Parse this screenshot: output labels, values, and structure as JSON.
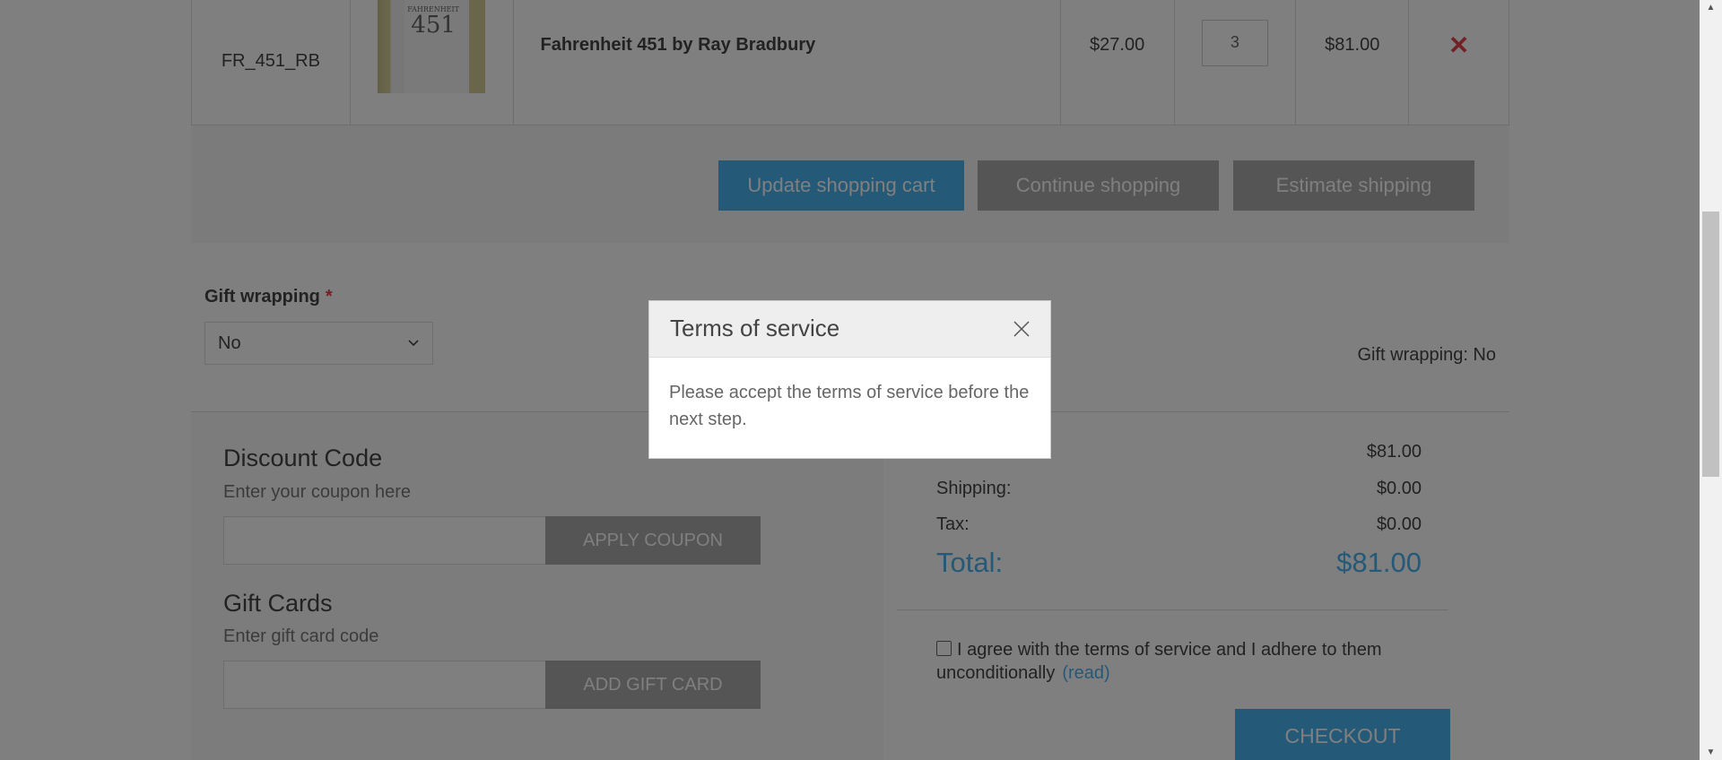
{
  "cart_row": {
    "sku": "FR_451_RB",
    "product_name": "Fahrenheit 451 by Ray Bradbury",
    "unit_price": "$27.00",
    "quantity": "3",
    "subtotal": "$81.00",
    "remove_symbol": "✕",
    "book_cover_top": "FAHRENHEIT",
    "book_cover_number": "451"
  },
  "cart_buttons": {
    "update": "Update shopping cart",
    "continue": "Continue shopping",
    "estimate": "Estimate shipping"
  },
  "gift_wrapping": {
    "label": "Gift wrapping",
    "required_mark": "*",
    "selected": "No",
    "summary": "Gift wrapping: No"
  },
  "discount": {
    "title": "Discount Code",
    "hint": "Enter your coupon here",
    "input_value": "",
    "button": "APPLY COUPON"
  },
  "gift_cards": {
    "title": "Gift Cards",
    "hint": "Enter gift card code",
    "input_value": "",
    "button": "ADD GIFT CARD"
  },
  "totals": {
    "subtotal_value": "$81.00",
    "shipping_label": "Shipping:",
    "shipping_value": "$0.00",
    "tax_label": "Tax:",
    "tax_value": "$0.00",
    "total_label": "Total:",
    "total_value": "$81.00"
  },
  "terms": {
    "agree_text": "I agree with the terms of service and I adhere to them unconditionally",
    "read_link": "(read)",
    "checkout": "CHECKOUT"
  },
  "modal": {
    "title": "Terms of service",
    "message": "Please accept the terms of service before the next step."
  },
  "colors": {
    "accent": "#4ab2f1",
    "remove": "#e4434b",
    "secondary_button": "#aaaaaa",
    "overlay": "rgba(0,0,0,0.5)"
  },
  "icons": {
    "close": "close-icon",
    "remove": "remove-icon",
    "dropdown": "chevron-down-icon",
    "checkbox": "checkbox-icon"
  }
}
